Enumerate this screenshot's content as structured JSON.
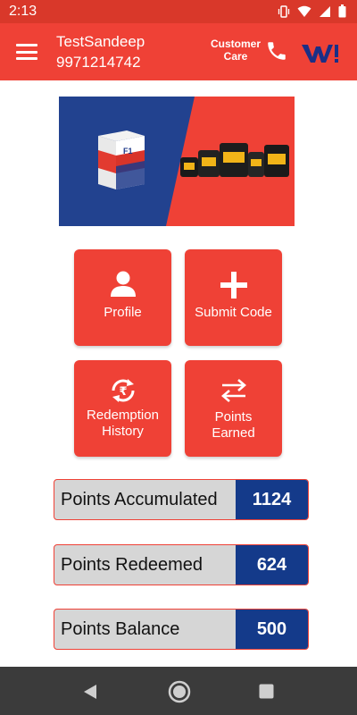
{
  "status_bar": {
    "time": "2:13"
  },
  "header": {
    "user_name": "TestSandeep",
    "user_phone": "9971214742",
    "customer_care_label": "Customer\nCare"
  },
  "banner": {
    "product_box_text": "F1"
  },
  "tiles": [
    {
      "label": "Profile",
      "icon": "person-icon"
    },
    {
      "label": "Submit Code",
      "icon": "plus-icon"
    },
    {
      "label": "Redemption\nHistory",
      "icon": "rupee-refresh-icon"
    },
    {
      "label": "Points\nEarned",
      "icon": "swap-arrows-icon"
    }
  ],
  "points": [
    {
      "label": "Points Accumulated",
      "value": "1124"
    },
    {
      "label": "Points Redeemed",
      "value": "624"
    },
    {
      "label": "Points Balance",
      "value": "500"
    }
  ],
  "colors": {
    "primary_red": "#ef4136",
    "status_red": "#d9382a",
    "value_blue": "#143a8a",
    "row_gray": "#d6d6d6",
    "nav_bar": "#3b3b3b"
  }
}
